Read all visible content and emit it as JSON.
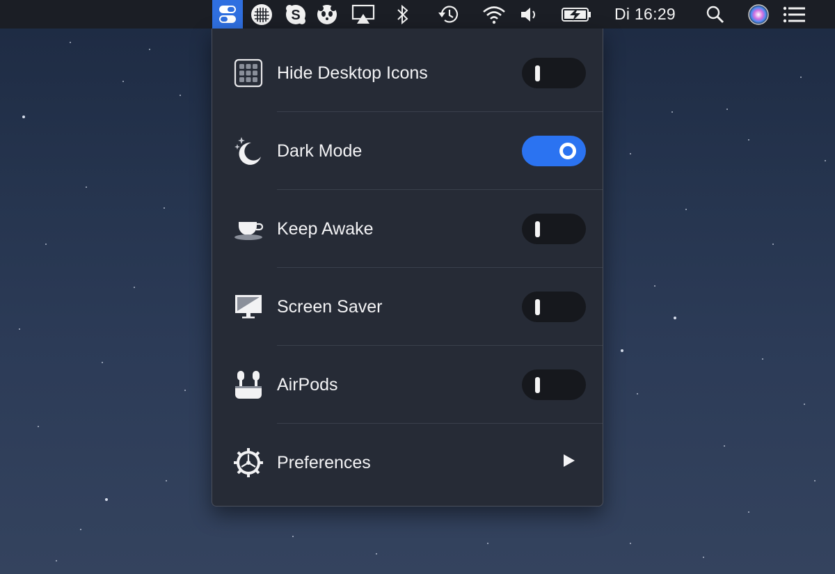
{
  "menubar": {
    "icons": [
      "one-switch-icon",
      "keyboard-grid-icon",
      "skype-icon",
      "panda-icon",
      "airplay-icon",
      "bluetooth-icon",
      "time-machine-icon",
      "wifi-icon",
      "volume-icon",
      "battery-icon",
      "spotlight-icon",
      "siri-icon",
      "notification-center-icon"
    ],
    "clock": "Di 16:29"
  },
  "panel": {
    "items": [
      {
        "label": "Hide Desktop Icons",
        "icon": "desktop-grid-icon",
        "control": "toggle",
        "on": false
      },
      {
        "label": "Dark Mode",
        "icon": "moon-stars-icon",
        "control": "toggle",
        "on": true
      },
      {
        "label": "Keep Awake",
        "icon": "coffee-cup-icon",
        "control": "toggle",
        "on": false
      },
      {
        "label": "Screen Saver",
        "icon": "monitor-icon",
        "control": "toggle",
        "on": false
      },
      {
        "label": "AirPods",
        "icon": "airpods-icon",
        "control": "toggle",
        "on": false
      },
      {
        "label": "Preferences",
        "icon": "gear-icon",
        "control": "submenu-arrow"
      }
    ]
  },
  "colors": {
    "accent": "#2b73f1",
    "panel_bg": "#262b36",
    "menubar_bg": "#1b1e25",
    "toggle_off_bg": "#16181d",
    "text": "#f3f3f5"
  }
}
